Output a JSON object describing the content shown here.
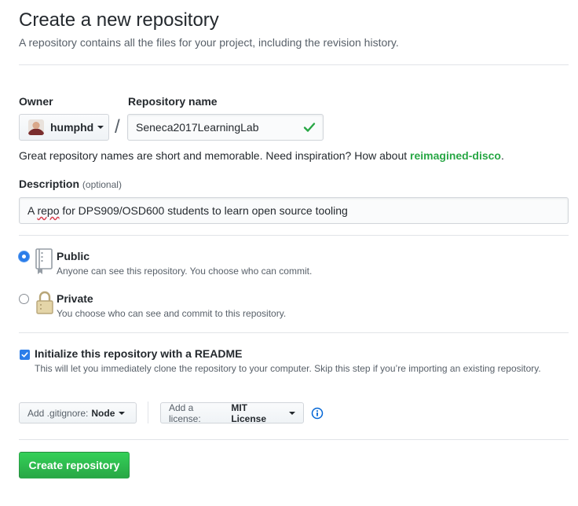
{
  "header": {
    "title": "Create a new repository",
    "subtitle": "A repository contains all the files for your project, including the revision history."
  },
  "owner": {
    "label": "Owner",
    "value": "humphd"
  },
  "repo_name": {
    "label": "Repository name",
    "value": "Seneca2017LearningLab",
    "separator": "/"
  },
  "hint": {
    "text": "Great repository names are short and memorable. Need inspiration? How about ",
    "suggestion": "reimagined-disco",
    "end": "."
  },
  "description": {
    "label": "Description",
    "optional": "(optional)",
    "value_prefix": "A ",
    "value_misspelled": "repo",
    "value_rest": " for DPS909/OSD600 students to learn open source tooling"
  },
  "visibility": {
    "public": {
      "title": "Public",
      "desc": "Anyone can see this repository. You choose who can commit.",
      "selected": true
    },
    "private": {
      "title": "Private",
      "desc": "You choose who can see and commit to this repository.",
      "selected": false
    }
  },
  "readme": {
    "title": "Initialize this repository with a README",
    "desc": "This will let you immediately clone the repository to your computer. Skip this step if you’re importing an existing repository.",
    "checked": true
  },
  "gitignore": {
    "label": "Add .gitignore:",
    "value": "Node"
  },
  "license": {
    "label": "Add a license:",
    "value": "MIT License"
  },
  "submit": {
    "label": "Create repository"
  },
  "colors": {
    "accent_green": "#28a745",
    "accent_blue": "#2b7de9",
    "text": "#24292e",
    "muted": "#586069"
  }
}
